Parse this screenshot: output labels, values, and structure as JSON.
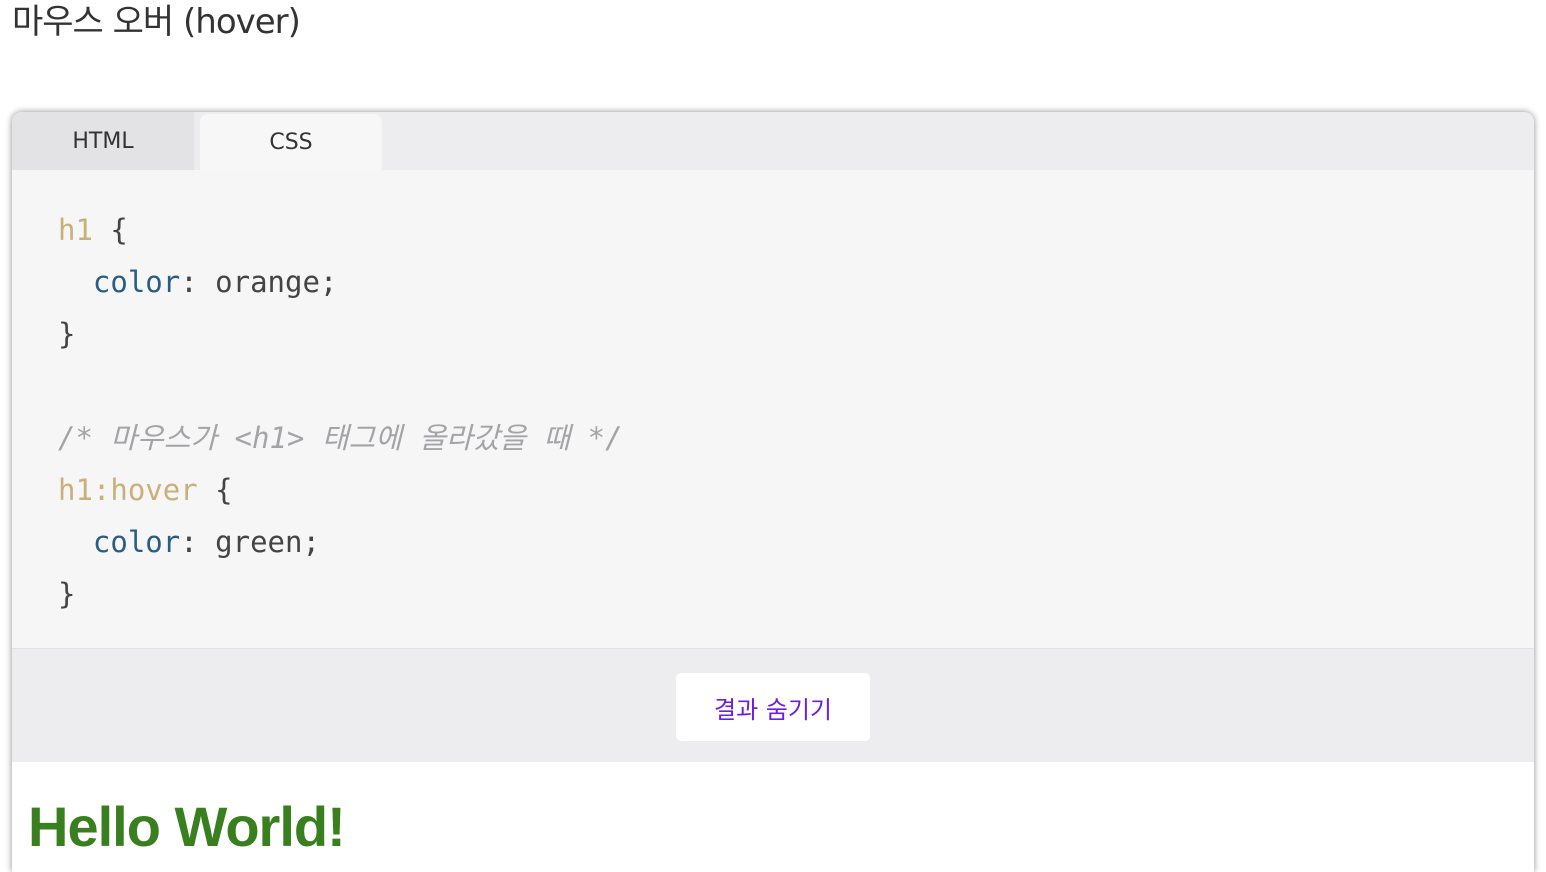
{
  "section_title": "마우스 오버 (hover)",
  "tabs": [
    {
      "label": "HTML",
      "active": false
    },
    {
      "label": "CSS",
      "active": true
    }
  ],
  "code": {
    "l1_sel": "h1",
    "l1_brace": " {",
    "l2_prop": "color",
    "l2_rest": ": orange;",
    "l3": "}",
    "l5_comment": "/* 마우스가 <h1> 태그에 올라갔을 때 */",
    "l6_sel": "h1:hover",
    "l6_brace": " {",
    "l7_prop": "color",
    "l7_rest": ": green;",
    "l8": "}"
  },
  "toggle_button_label": "결과 숨기기",
  "result": {
    "heading_text": "Hello World!",
    "heading_color": "#3a7f1f"
  },
  "colors": {
    "selector": "#c9b07a",
    "property": "#2a5d84",
    "comment": "#a4a4a8",
    "button_text": "#6d1fe0"
  }
}
